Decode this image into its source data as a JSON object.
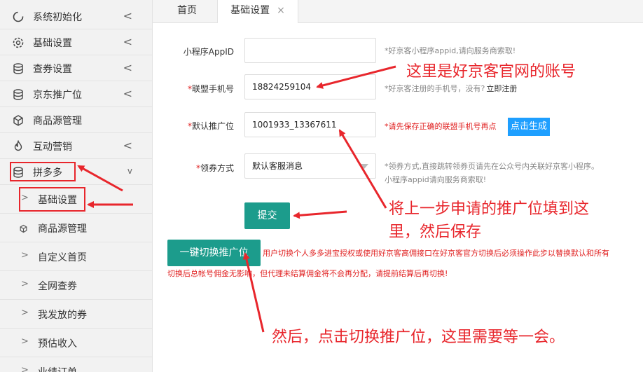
{
  "sidebar": {
    "items": [
      {
        "label": "系统初始化",
        "icon": "loading-circle-icon",
        "chevron": "<"
      },
      {
        "label": "基础设置",
        "icon": "gear-icon",
        "chevron": "<"
      },
      {
        "label": "查券设置",
        "icon": "database-icon",
        "chevron": "<"
      },
      {
        "label": "京东推广位",
        "icon": "database-icon",
        "chevron": "<"
      },
      {
        "label": "商品源管理",
        "icon": "cube-icon",
        "chevron": ""
      },
      {
        "label": "互动营销",
        "icon": "flame-icon",
        "chevron": "<"
      },
      {
        "label": "拼多多",
        "icon": "database-icon",
        "chevron": "v"
      }
    ],
    "sub_items": [
      {
        "label": "基础设置",
        "caret": ">"
      },
      {
        "label": "商品源管理",
        "caret": ""
      },
      {
        "label": "自定义首页",
        "caret": ">"
      },
      {
        "label": "全网查券",
        "caret": ">"
      },
      {
        "label": "我发放的券",
        "caret": ">"
      },
      {
        "label": "预估收入",
        "caret": ">"
      },
      {
        "label": "业绩订单",
        "caret": ">"
      }
    ]
  },
  "tabs": {
    "home": "首页",
    "active": "基础设置",
    "close": "×"
  },
  "form": {
    "appid": {
      "label": "小程序AppID",
      "value": "",
      "hint": "*好京客小程序appid,请向服务商索取!"
    },
    "phone": {
      "label_req": "*",
      "label": "联盟手机号",
      "value": "18824259104",
      "hint": "*好京客注册的手机号，没有?",
      "hint_link": "立即注册"
    },
    "pid": {
      "label_req": "*",
      "label": "默认推广位",
      "value": "1001933_13367611",
      "hint": "*请先保存正确的联盟手机号再点",
      "gen_button": "点击生成"
    },
    "coupon": {
      "label_req": "*",
      "label": "领券方式",
      "value": "默认客服消息",
      "hint_line1": "*领券方式,直接跳转领券页请先在公众号内关联好京客小程序。",
      "hint_line2": "小程序appid请向服务商索取!"
    },
    "submit": "提交"
  },
  "switch": {
    "button": "一键切换推广位",
    "note1": "用户切换个人多多进宝授权或使用好京客高佣接口在好京客官方切换后必须操作此步以替换默认和所有",
    "note2": "切换后总帐号佣金无影响，但代理未结算佣金将不会再分配，请提前结算后再切换!"
  },
  "annotations": {
    "a1": "这里是好京客官网的账号",
    "a2_line1": "将上一步申请的推广位填到这",
    "a2_line2": "里，然后保存",
    "a3": "然后，点击切换推广位，这里需要等一会。"
  },
  "colors": {
    "accent_teal": "#1c9c8c",
    "link_blue": "#1e9fff",
    "annotation_red": "#e8262c",
    "warning_red": "#e02020"
  }
}
